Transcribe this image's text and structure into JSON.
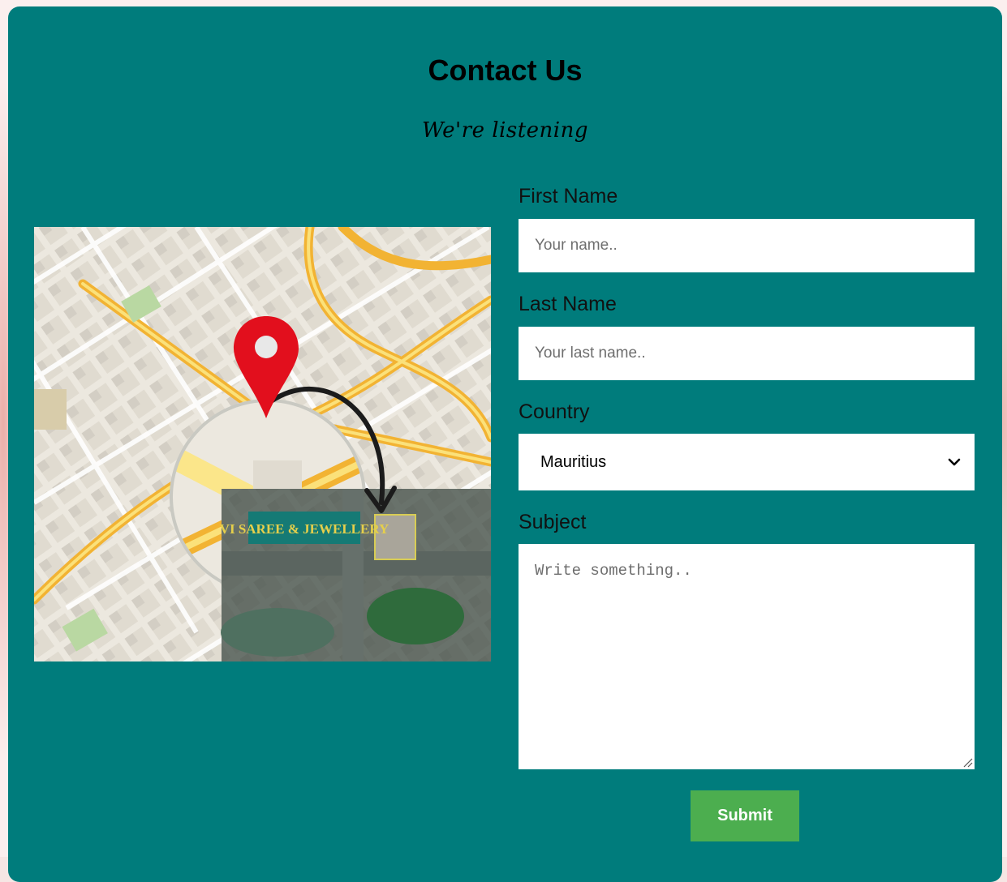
{
  "header": {
    "title": "Contact Us",
    "subtitle": "We're listening"
  },
  "map": {
    "banner_text": "VI SAREE & JEWELLERY",
    "pin_color": "#e20f1d"
  },
  "form": {
    "first_name": {
      "label": "First Name",
      "placeholder": "Your name.."
    },
    "last_name": {
      "label": "Last Name",
      "placeholder": "Your last name.."
    },
    "country": {
      "label": "Country",
      "selected": "Mauritius"
    },
    "subject": {
      "label": "Subject",
      "placeholder": "Write something.."
    },
    "submit_label": "Submit"
  },
  "colors": {
    "card": "#007c7c",
    "submit": "#4cae4f"
  }
}
